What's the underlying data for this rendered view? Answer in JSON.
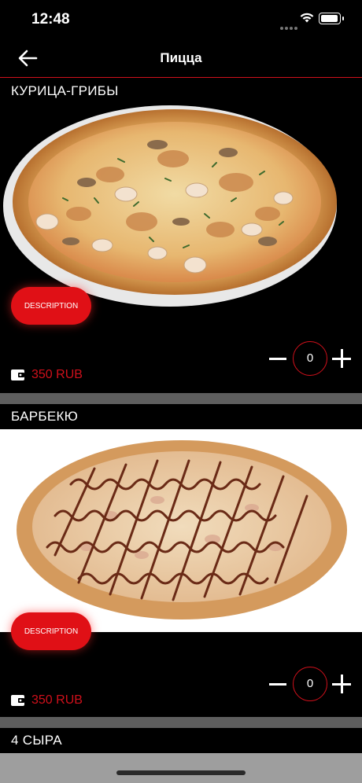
{
  "status_bar": {
    "time": "12:48"
  },
  "nav": {
    "title": "Пицца"
  },
  "products": [
    {
      "title": "КУРИЦА-ГРИБЫ",
      "description_label": "DESCRIPTION",
      "quantity": "0",
      "price": "350 RUB"
    },
    {
      "title": "БАРБЕКЮ",
      "description_label": "DESCRIPTION",
      "quantity": "0",
      "price": "350 RUB"
    },
    {
      "title": "4 СЫРА"
    }
  ],
  "colors": {
    "accent": "#d0101b",
    "button": "#e01016",
    "background": "#000000",
    "divider": "#5e5e5e"
  }
}
